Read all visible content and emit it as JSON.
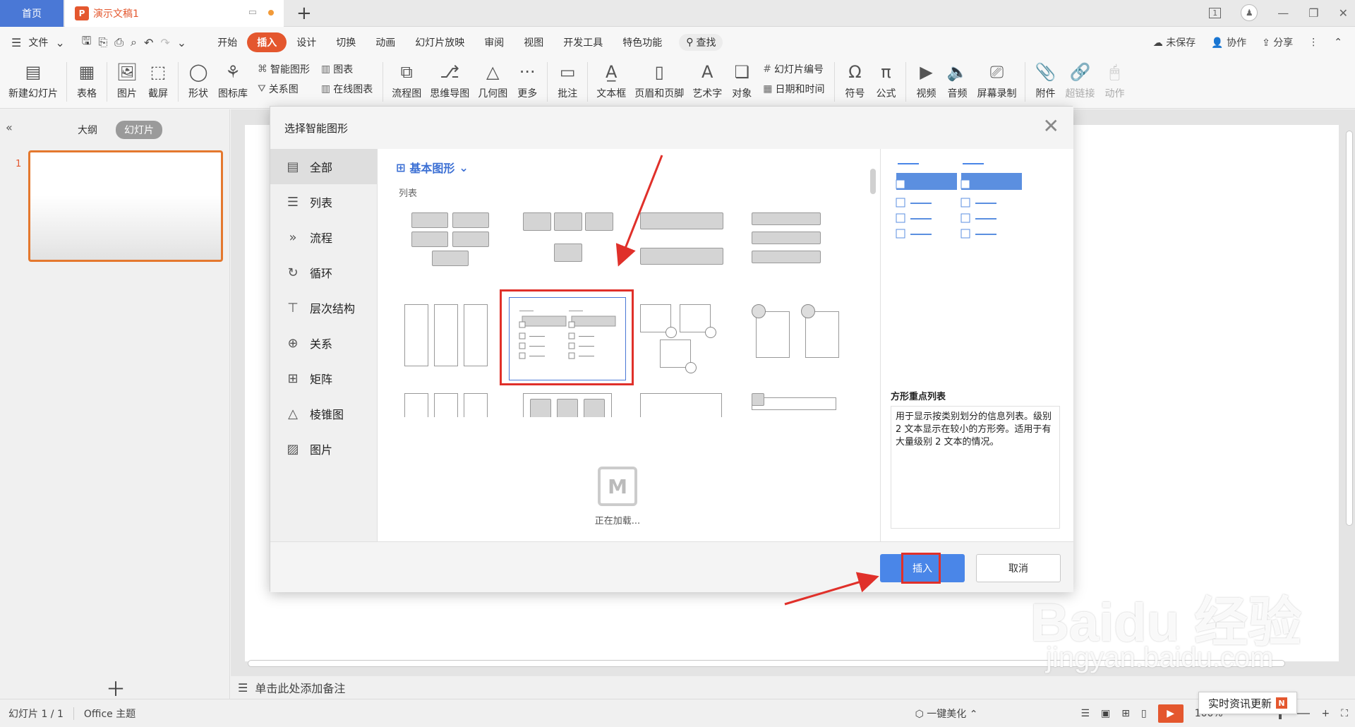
{
  "tabbar": {
    "home_label": "首页",
    "doc_tab_label": "演示文稿1",
    "doc_badge": "P",
    "add_icon": "+",
    "page_indicator": "1"
  },
  "menubar": {
    "file_label": "文件",
    "tabs": [
      "开始",
      "插入",
      "设计",
      "切换",
      "动画",
      "幻灯片放映",
      "审阅",
      "视图",
      "开发工具",
      "特色功能"
    ],
    "active_tab": "插入",
    "search_label": "查找",
    "unsaved_label": "未保存",
    "collab_label": "协作",
    "share_label": "分享"
  },
  "ribbon": {
    "new_slide": "新建幻灯片",
    "table": "表格",
    "image": "图片",
    "screenshot": "截屏",
    "shape": "形状",
    "icon_lib": "图标库",
    "smart_art": "智能图形",
    "chart": "图表",
    "relation": "关系图",
    "online_chart": "在线图表",
    "flowchart": "流程图",
    "mindmap": "思维导图",
    "geometry": "几何图",
    "more": "更多",
    "comment": "批注",
    "textbox": "文本框",
    "header_footer": "页眉和页脚",
    "wordart": "艺术字",
    "object": "对象",
    "slide_number": "幻灯片编号",
    "date_time": "日期和时间",
    "symbol": "符号",
    "formula": "公式",
    "video": "视频",
    "audio": "音频",
    "screen_record": "屏幕录制",
    "attachment": "附件",
    "hyperlink": "超链接",
    "action": "动作"
  },
  "leftpanel": {
    "outline_tab": "大纲",
    "slides_tab": "幻灯片",
    "slide_number": "1"
  },
  "notes": {
    "placeholder": "单击此处添加备注"
  },
  "statusbar": {
    "slide_info": "幻灯片 1 / 1",
    "theme": "Office 主题",
    "beautify": "一键美化",
    "zoom": "100%"
  },
  "news_popup": {
    "label": "实时资讯更新",
    "badge": "N"
  },
  "dialog": {
    "title": "选择智能图形",
    "categories": [
      "全部",
      "列表",
      "流程",
      "循环",
      "层次结构",
      "关系",
      "矩阵",
      "棱锥图",
      "图片"
    ],
    "active_category": "全部",
    "gallery_header": "基本图形",
    "gallery_section": "列表",
    "loading_text": "正在加载...",
    "preview_title": "方形重点列表",
    "preview_description": "用于显示按类别划分的信息列表。级别 2 文本显示在较小的方形旁。适用于有大量级别 2 文本的情况。",
    "insert_button": "插入",
    "cancel_button": "取消"
  },
  "watermark": {
    "brand": "Baidu 经验",
    "url": "jingyan.baidu.com"
  },
  "colors": {
    "accent": "#e4572e",
    "primary_blue": "#4a86e8",
    "highlight_red": "#e0302a"
  }
}
